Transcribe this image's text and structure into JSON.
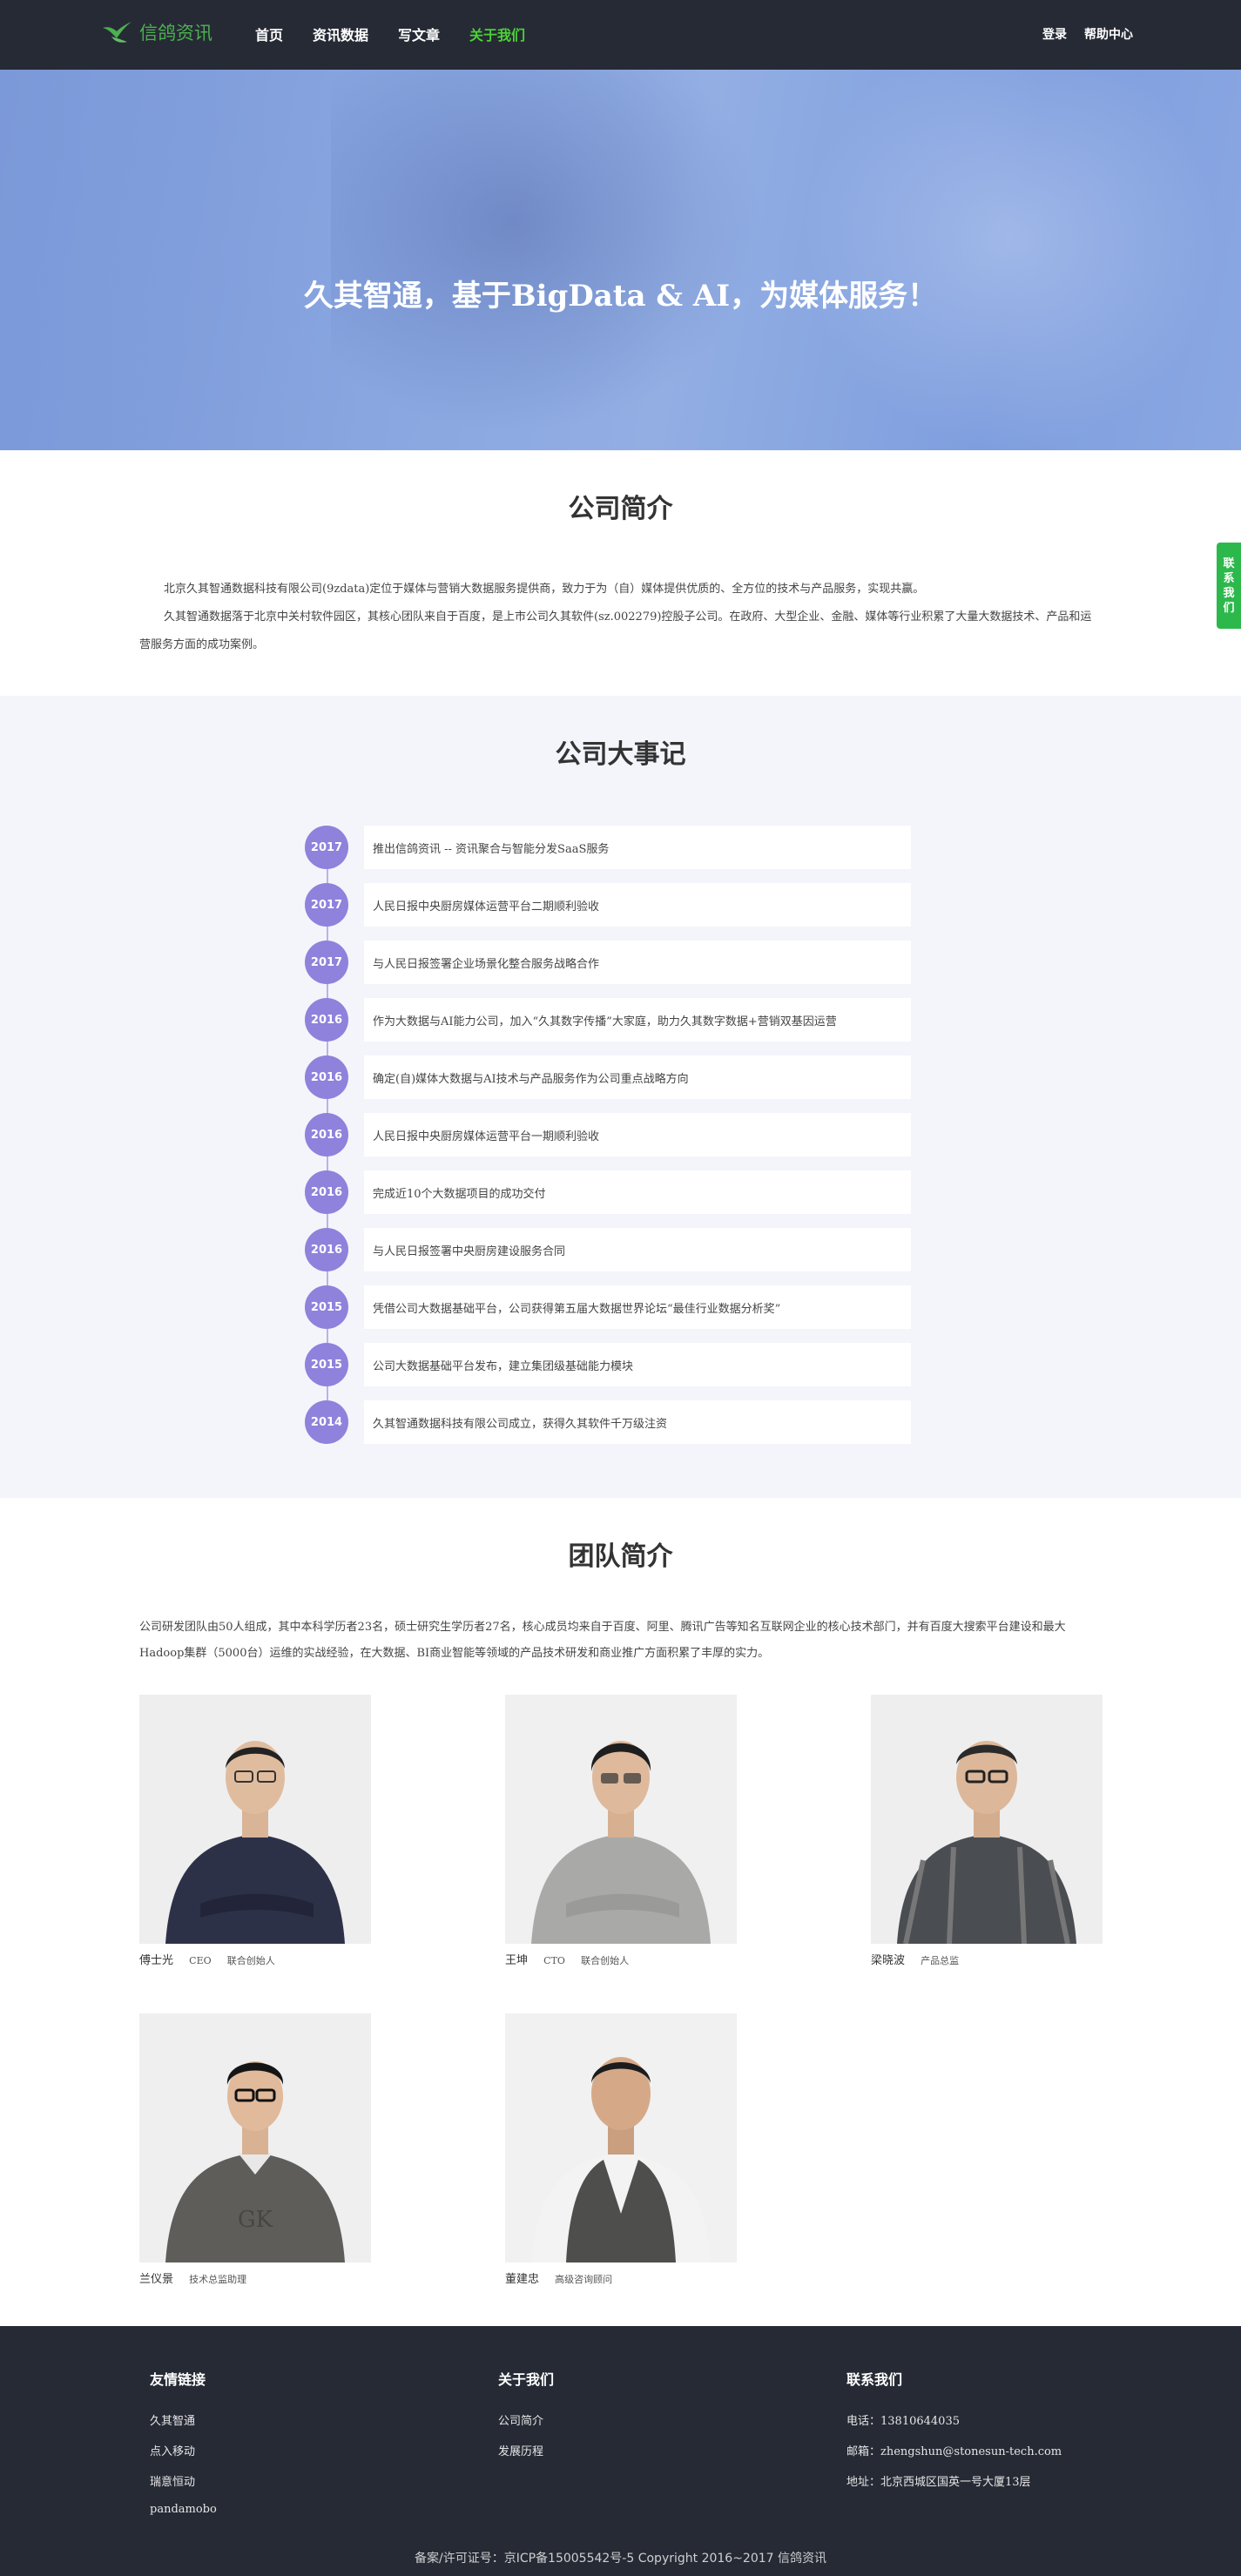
{
  "nav": {
    "logo_text": "信鸽资讯",
    "links": [
      "首页",
      "资讯数据",
      "写文章",
      "关于我们"
    ],
    "login": "登录",
    "help": "帮助中心"
  },
  "hero": {
    "title": "久其智通，基于BigData & AI，为媒体服务！"
  },
  "intro": {
    "title": "公司简介",
    "paragraphs": [
      "北京久其智通数据科技有限公司(9zdata)定位于媒体与营销大数据服务提供商，致力于为（自）媒体提供优质的、全方位的技术与产品服务，实现共赢。",
      "久其智通数据落于北京中关村软件园区，其核心团队来自于百度，是上市公司久其软件(sz.002279)控股子公司。在政府、大型企业、金融、媒体等行业积累了大量大数据技术、产品和运营服务方面的成功案例。"
    ]
  },
  "history": {
    "title": "公司大事记",
    "events": [
      {
        "year": "2017",
        "text": "推出信鸽资讯 -- 资讯聚合与智能分发SaaS服务"
      },
      {
        "year": "2017",
        "text": "人民日报中央厨房媒体运营平台二期顺利验收"
      },
      {
        "year": "2017",
        "text": "与人民日报签署企业场景化整合服务战略合作"
      },
      {
        "year": "2016",
        "text": "作为大数据与AI能力公司，加入“久其数字传播”大家庭，助力久其数字数据+营销双基因运营"
      },
      {
        "year": "2016",
        "text": "确定(自)媒体大数据与AI技术与产品服务作为公司重点战略方向"
      },
      {
        "year": "2016",
        "text": "人民日报中央厨房媒体运营平台一期顺利验收"
      },
      {
        "year": "2016",
        "text": "完成近10个大数据项目的成功交付"
      },
      {
        "year": "2016",
        "text": "与人民日报签署中央厨房建设服务合同"
      },
      {
        "year": "2015",
        "text": "凭借公司大数据基础平台，公司获得第五届大数据世界论坛“最佳行业数据分析奖”"
      },
      {
        "year": "2015",
        "text": "公司大数据基础平台发布，建立集团级基础能力模块"
      },
      {
        "year": "2014",
        "text": "久其智通数据科技有限公司成立，获得久其软件千万级注资"
      }
    ]
  },
  "team": {
    "title": "团队简介",
    "description": "公司研发团队由50人组成，其中本科学历者23名，硕士研究生学历者27名，核心成员均来自于百度、阿里、腾讯广告等知名互联网企业的核心技术部门，并有百度大搜索平台建设和最大Hadoop集群（5000台）运维的实战经验，在大数据、BI商业智能等领域的产品技术研发和商业推广方面积累了丰厚的实力。",
    "members": [
      {
        "name": "傅士光",
        "role": "CEO",
        "title": "联合创始人",
        "shirt": "#2d3148"
      },
      {
        "name": "王坤",
        "role": "CTO",
        "title": "联合创始人",
        "shirt": "#a9aaa8"
      },
      {
        "name": "梁晓波",
        "role": "",
        "title": "产品总监",
        "shirt": "#4a4d52"
      },
      {
        "name": "兰仪景",
        "role": "",
        "title": "技术总监助理",
        "shirt": "#5e5d5a"
      },
      {
        "name": "董建忠",
        "role": "",
        "title": "高级咨询顾问",
        "shirt": "#4e4e4c"
      }
    ]
  },
  "footer": {
    "links_title": "友情链接",
    "links": [
      "久其智通",
      "点入移动",
      "瑞意恒动",
      "pandamobo"
    ],
    "about_title": "关于我们",
    "about_links": [
      "公司简介",
      "发展历程"
    ],
    "contact_title": "联系我们",
    "phone": "电话：13810644035",
    "email": "邮箱：zhengshun@stonesun-tech.com",
    "address": "地址：北京西城区国英一号大厦13层",
    "copyright": "备案/许可证号：京ICP备15005542号-5 Copyright 2016~2017 信鸽资讯"
  },
  "side_tab": {
    "label": [
      "联",
      "系",
      "我",
      "们"
    ]
  },
  "colors": {
    "nav_bg": "#262a35",
    "accent_green": "#4cd137",
    "timeline_purple": "#8e82dc",
    "history_bg": "#f3f5fb",
    "side_tab_green": "#2db84c"
  }
}
